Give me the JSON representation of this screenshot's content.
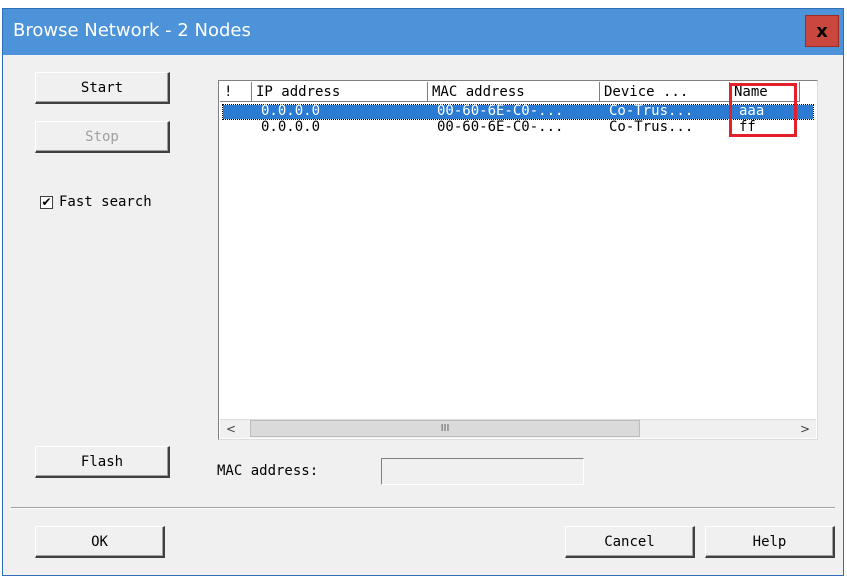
{
  "window": {
    "title": "Browse Network - 2 Nodes",
    "close_label": "x"
  },
  "buttons": {
    "start": "Start",
    "stop": "Stop",
    "flash": "Flash",
    "ok": "OK",
    "cancel": "Cancel",
    "help": "Help"
  },
  "fast_search": {
    "label": "Fast search",
    "checked": true,
    "mark": "✔"
  },
  "list": {
    "columns": [
      "!",
      "IP address",
      "MAC address",
      "Device ...",
      "Name"
    ],
    "rows": [
      {
        "flag": "",
        "ip": "0.0.0.0",
        "mac": "00-60-6E-C0-...",
        "device": "Co-Trus...",
        "name": "aaa",
        "selected": true
      },
      {
        "flag": "",
        "ip": "0.0.0.0",
        "mac": "00-60-6E-C0-...",
        "device": "Co-Trus...",
        "name": "ff",
        "selected": false
      }
    ],
    "scroll_left": "<",
    "scroll_right": ">",
    "scroll_thumb": "III"
  },
  "mac_address": {
    "label": "MAC address:",
    "value": ""
  },
  "colors": {
    "titlebar": "#4c93d9",
    "close_button": "#c9473f",
    "selection": "#2b7bd3",
    "highlight_box": "#e3202a"
  }
}
